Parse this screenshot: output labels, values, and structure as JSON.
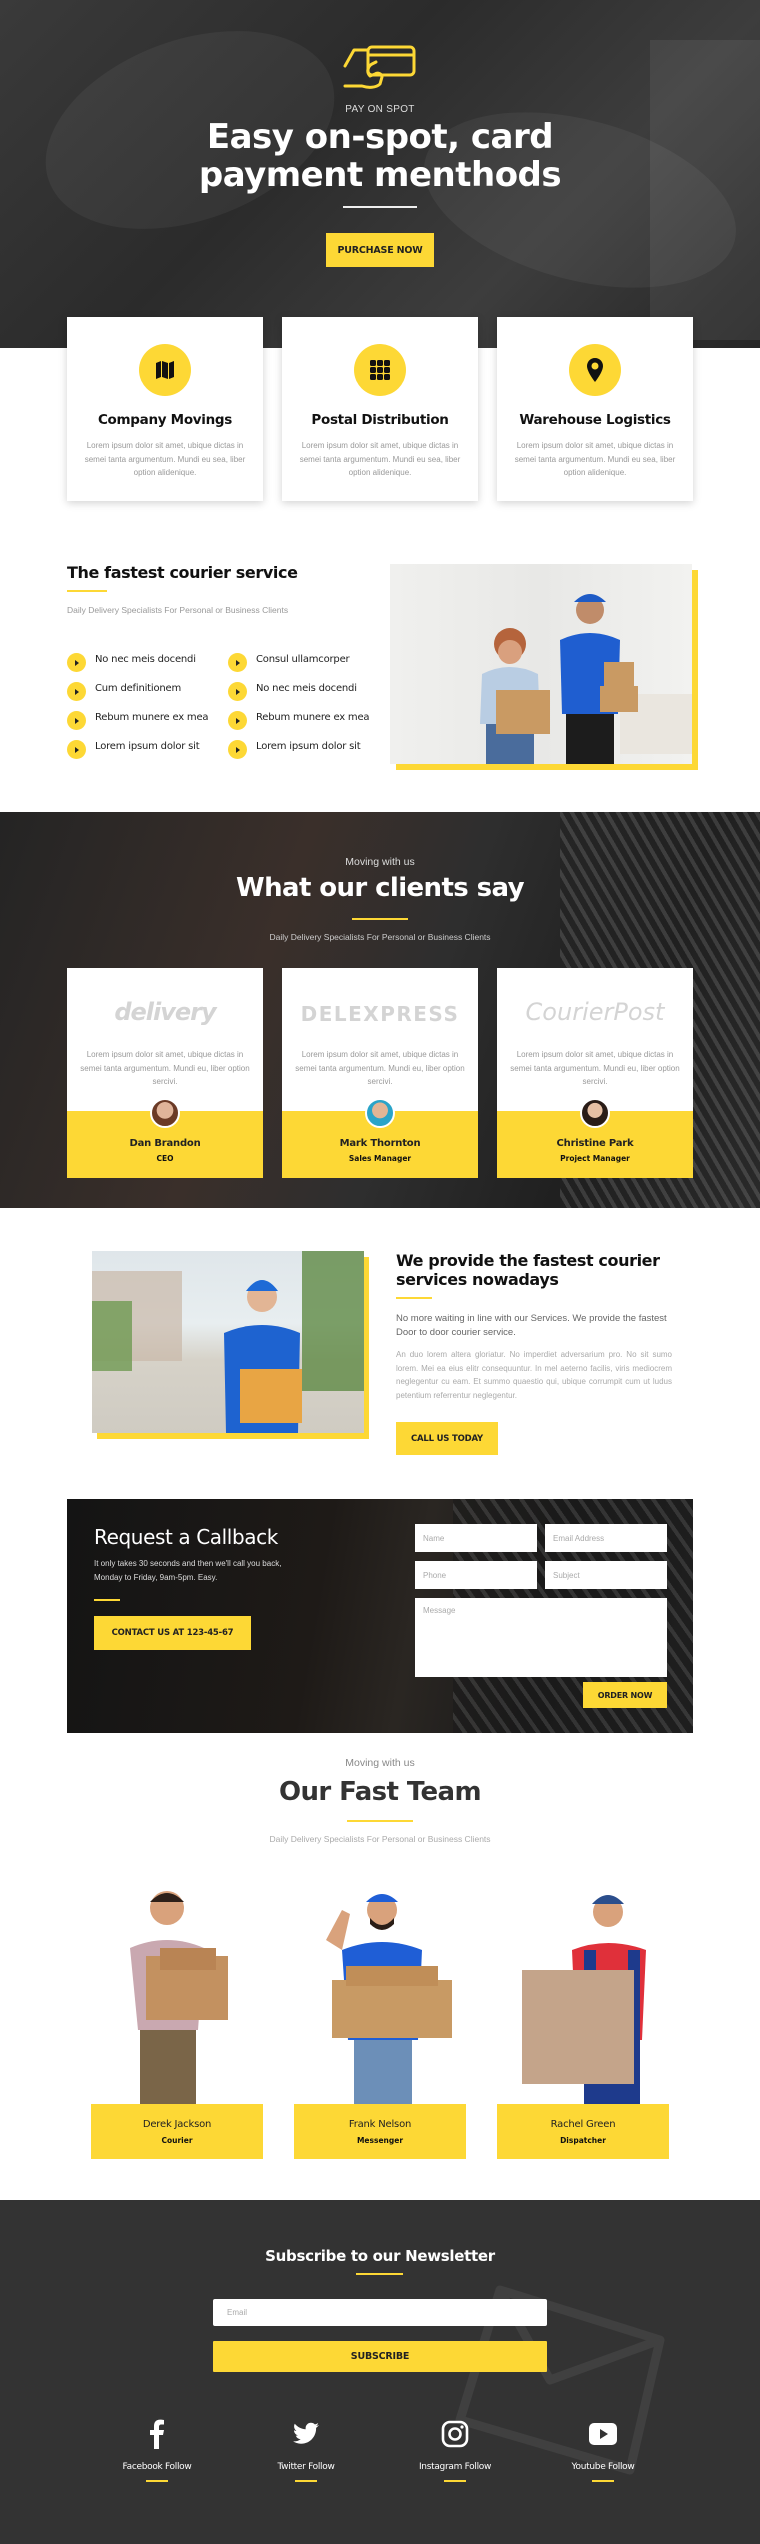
{
  "colors": {
    "accent": "#fdd835",
    "dark": "#333333",
    "text": "#222222",
    "muted": "#999999"
  },
  "hero": {
    "icon": "card-payment-icon",
    "eyebrow": "PAY ON SPOT",
    "title_line1": "Easy on-spot, card",
    "title_line2": "payment menthods",
    "button": "PURCHASE NOW"
  },
  "services": [
    {
      "icon": "map-icon",
      "title": "Company Movings",
      "text": "Lorem ipsum dolor sit amet, ubique dictas in semei tanta argumentum. Mundi eu sea, liber option alidenique."
    },
    {
      "icon": "grid-icon",
      "title": "Postal Distribution",
      "text": "Lorem ipsum dolor sit amet, ubique dictas in semei tanta argumentum. Mundi eu sea, liber option alidenique."
    },
    {
      "icon": "map-pin-icon",
      "title": "Warehouse Logistics",
      "text": "Lorem ipsum dolor sit amet, ubique dictas in semei tanta argumentum. Mundi eu sea, liber option alidenique."
    }
  ],
  "fastest": {
    "title": "The fastest courier service",
    "subtitle": "Daily Delivery Specialists For Personal or Business Clients",
    "list_left": [
      "No nec meis docendi",
      "Cum definitionem",
      "Rebum munere ex mea",
      "Lorem ipsum dolor sit"
    ],
    "list_right": [
      "Consul ullamcorper",
      "No nec meis docendi",
      "Rebum munere ex mea",
      "Lorem ipsum dolor sit"
    ]
  },
  "testimonials": {
    "eyebrow": "Moving with us",
    "title": "What our clients say",
    "subtitle": "Daily Delivery Specialists For Personal or Business Clients",
    "items": [
      {
        "logo": "delivery",
        "text": "Lorem ipsum dolor sit amet, ubique dictas in semei tanta argumentum. Mundi eu, liber option sercivi.",
        "name": "Dan Brandon",
        "role": "CEO"
      },
      {
        "logo": "DELEXPRESS",
        "text": "Lorem ipsum dolor sit amet, ubique dictas in semei tanta argumentum. Mundi eu, liber option sercivi.",
        "name": "Mark Thornton",
        "role": "Sales Manager"
      },
      {
        "logo": "CourierPost",
        "text": "Lorem ipsum dolor sit amet, ubique dictas in semei tanta argumentum. Mundi eu, liber option sercivi.",
        "name": "Christine Park",
        "role": "Project Manager"
      }
    ]
  },
  "provide": {
    "title": "We provide the fastest courier services nowadays",
    "lead": "No more waiting in line with our Services. We provide the fastest Door to door courier service.",
    "body": "An duo lorem altera gloriatur. No imperdiet adversarium pro. No sit sumo lorem. Mei ea eius elitr consequuntur. In mel aeterno facilis, viris mediocrem neglegentur cu eam. Et summo quaestio qui, ubique corrumpit cum ut ludus petentium referrentur neglegentur.",
    "button": "CALL US TODAY"
  },
  "callback": {
    "title": "Request a Callback",
    "text": "It only takes 30 seconds and then we'll call you back, Monday to Friday, 9am-5pm. Easy.",
    "contact_button": "CONTACT US AT 123-45-67",
    "fields": {
      "name": "Name",
      "email": "Email Address",
      "phone": "Phone",
      "subject": "Subject",
      "message": "Message"
    },
    "submit": "ORDER NOW"
  },
  "team": {
    "eyebrow": "Moving with us",
    "title": "Our Fast Team",
    "subtitle": "Daily Delivery Specialists For Personal or Business Clients",
    "members": [
      {
        "name": "Derek Jackson",
        "role": "Courier"
      },
      {
        "name": "Frank Nelson",
        "role": "Messenger"
      },
      {
        "name": "Rachel Green",
        "role": "Dispatcher"
      }
    ]
  },
  "newsletter": {
    "title": "Subscribe to our Newsletter",
    "email_placeholder": "Email",
    "button": "SUBSCRIBE"
  },
  "social": [
    {
      "icon": "facebook-icon",
      "label": "Facebook Follow"
    },
    {
      "icon": "twitter-icon",
      "label": "Twitter Follow"
    },
    {
      "icon": "instagram-icon",
      "label": "Instagram Follow"
    },
    {
      "icon": "youtube-icon",
      "label": "Youtube Follow"
    }
  ]
}
